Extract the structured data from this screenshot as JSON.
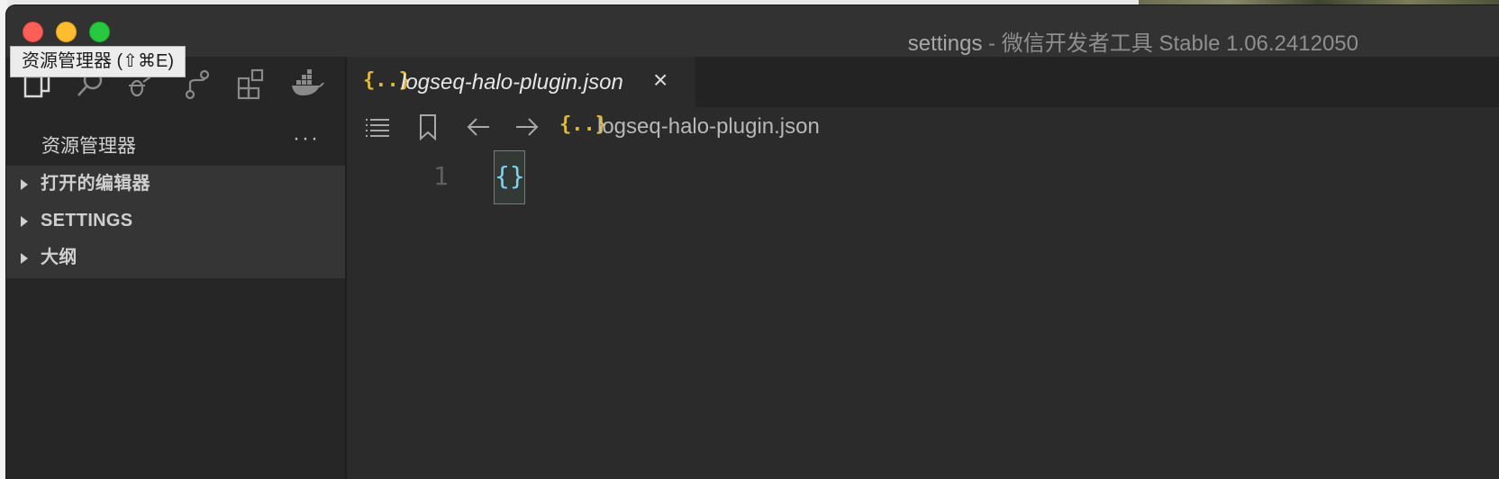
{
  "window": {
    "title_main": "settings",
    "title_suffix": " - 微信开发者工具 Stable 1.06.2412050"
  },
  "tooltip": {
    "text": "资源管理器 (⇧⌘E)"
  },
  "activity_bar": {
    "icons": [
      "files-icon",
      "search-icon",
      "debug-icon",
      "source-control-icon",
      "extensions-icon",
      "docker-icon"
    ]
  },
  "sidebar": {
    "title": "资源管理器",
    "more": "···",
    "sections": [
      {
        "label": "打开的编辑器",
        "expanded": false
      },
      {
        "label": "SETTINGS",
        "expanded": false
      },
      {
        "label": "大纲",
        "expanded": false
      }
    ]
  },
  "editor": {
    "tab": {
      "icon": "{..}",
      "label": "logseq-halo-plugin.json",
      "close": "×",
      "italic": true
    },
    "breadcrumb": {
      "icon": "{..}",
      "label": "logseq-halo-plugin.json"
    },
    "lines": [
      {
        "number": "1",
        "text": "{}"
      }
    ]
  },
  "colors": {
    "accent_json": "#e2b93d",
    "bracket": "#7fd3f0"
  }
}
